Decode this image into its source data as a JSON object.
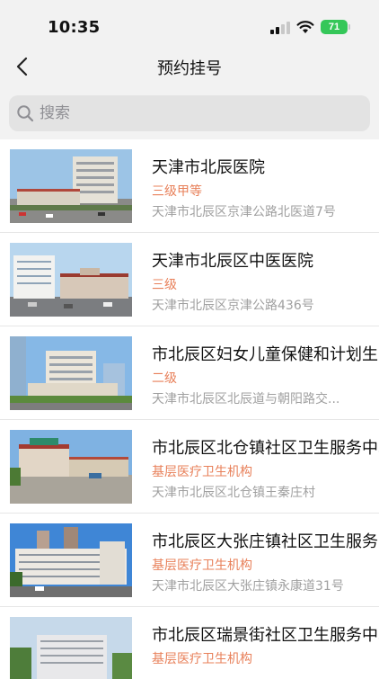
{
  "status_bar": {
    "time": "10:35",
    "battery": "71"
  },
  "nav": {
    "title": "预约挂号"
  },
  "search": {
    "placeholder": "搜索"
  },
  "colors": {
    "level_text": "#e8805a",
    "address_text": "#a0a0a0",
    "battery": "#35c759"
  },
  "hospitals": [
    {
      "name": "天津市北辰医院",
      "level": "三级甲等",
      "address": "天津市北辰区京津公路北医道7号"
    },
    {
      "name": "天津市北辰区中医医院",
      "level": "三级",
      "address": "天津市北辰区京津公路436号"
    },
    {
      "name": "市北辰区妇女儿童保健和计划生育服务中心",
      "level": "二级",
      "address": "天津市北辰区北辰道与朝阳路交..."
    },
    {
      "name": "市北辰区北仓镇社区卫生服务中心",
      "level": "基层医疗卫生机构",
      "address": "天津市北辰区北仓镇王秦庄村"
    },
    {
      "name": "市北辰区大张庄镇社区卫生服务中心",
      "level": "基层医疗卫生机构",
      "address": "天津市北辰区大张庄镇永康道31号"
    },
    {
      "name": "市北辰区瑞景街社区卫生服务中心",
      "level": "基层医疗卫生机构",
      "address": ""
    }
  ]
}
